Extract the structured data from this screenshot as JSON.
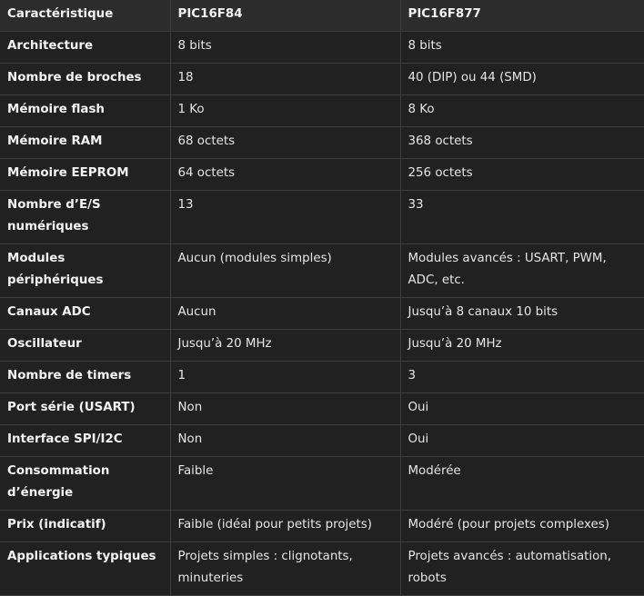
{
  "table": {
    "headers": [
      "Caractéristique",
      "PIC16F84",
      "PIC16F877"
    ],
    "rows": [
      [
        "Architecture",
        "8 bits",
        "8 bits"
      ],
      [
        "Nombre de broches",
        "18",
        "40 (DIP) ou 44 (SMD)"
      ],
      [
        "Mémoire flash",
        "1 Ko",
        "8 Ko"
      ],
      [
        "Mémoire RAM",
        "68 octets",
        "368 octets"
      ],
      [
        "Mémoire EEPROM",
        "64 octets",
        "256 octets"
      ],
      [
        "Nombre d’E/S numériques",
        "13",
        "33"
      ],
      [
        "Modules périphériques",
        "Aucun (modules simples)",
        "Modules avancés : USART, PWM, ADC, etc."
      ],
      [
        "Canaux ADC",
        "Aucun",
        "Jusqu’à 8 canaux 10 bits"
      ],
      [
        "Oscillateur",
        "Jusqu’à 20 MHz",
        "Jusqu’à 20 MHz"
      ],
      [
        "Nombre de timers",
        "1",
        "3"
      ],
      [
        "Port série (USART)",
        "Non",
        "Oui"
      ],
      [
        "Interface SPI/I2C",
        "Non",
        "Oui"
      ],
      [
        "Consommation d’énergie",
        "Faible",
        "Modérée"
      ],
      [
        "Prix (indicatif)",
        "Faible (idéal pour petits projets)",
        "Modéré (pour projets complexes)"
      ],
      [
        "Applications typiques",
        "Projets simples : clignotants, minuteries",
        "Projets avancés : automatisation, robots"
      ]
    ]
  }
}
